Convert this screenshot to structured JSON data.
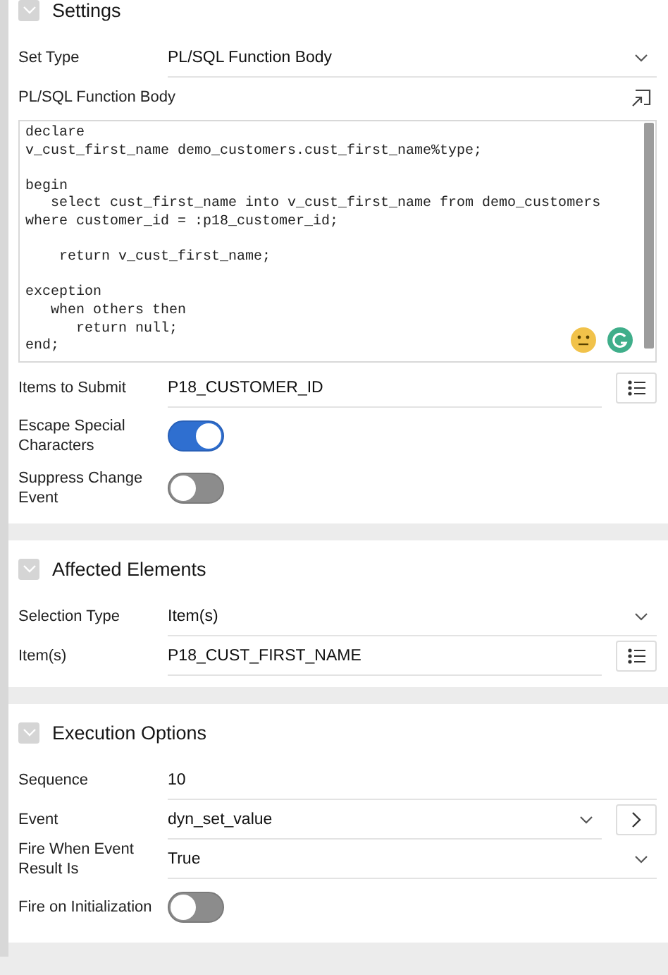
{
  "sections": [
    {
      "title": "Settings",
      "rows": [
        {
          "kind": "select",
          "label": "Set Type",
          "value": "PL/SQL Function Body"
        },
        {
          "kind": "code",
          "label": "PL/SQL Function Body",
          "code": "declare\nv_cust_first_name demo_customers.cust_first_name%type;\n\nbegin\n   select cust_first_name into v_cust_first_name from demo_customers\nwhere customer_id = :p18_customer_id;\n\n    return v_cust_first_name;\n\nexception\n   when others then\n      return null;\nend;"
        },
        {
          "kind": "text",
          "label": "Items to Submit",
          "value": "P18_CUSTOMER_ID",
          "list_button": true
        },
        {
          "kind": "toggle",
          "label": "Escape Special Characters",
          "on": true
        },
        {
          "kind": "toggle",
          "label": "Suppress Change Event",
          "on": false
        }
      ]
    },
    {
      "title": "Affected Elements",
      "rows": [
        {
          "kind": "select",
          "label": "Selection Type",
          "value": "Item(s)"
        },
        {
          "kind": "text",
          "label": "Item(s)",
          "value": "P18_CUST_FIRST_NAME",
          "list_button": true
        }
      ]
    },
    {
      "title": "Execution Options",
      "rows": [
        {
          "kind": "text",
          "label": "Sequence",
          "value": "10"
        },
        {
          "kind": "select",
          "label": "Event",
          "value": "dyn_set_value",
          "go_button": true
        },
        {
          "kind": "select",
          "label": "Fire When Event Result Is",
          "value": "True"
        },
        {
          "kind": "toggle",
          "label": "Fire on Initialization",
          "on": false
        }
      ]
    }
  ]
}
